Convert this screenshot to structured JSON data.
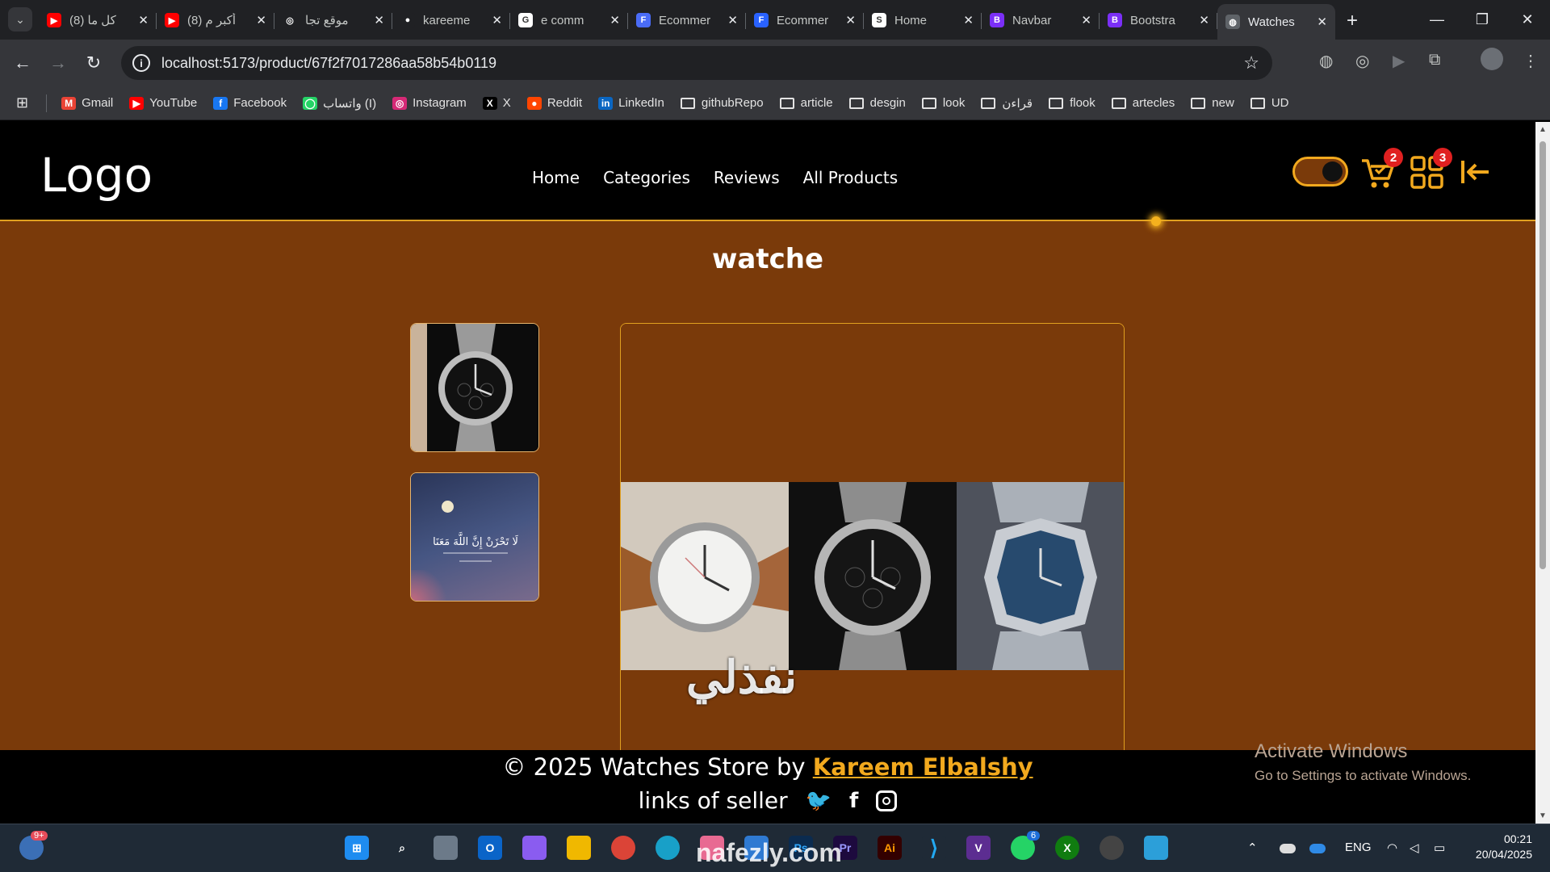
{
  "browser": {
    "tabs": [
      {
        "title": "(8) كل ما",
        "fav_color": "#ff0000",
        "fav_glyph": "▶"
      },
      {
        "title": "(8) أكبر م",
        "fav_color": "#ff0000",
        "fav_glyph": "▶"
      },
      {
        "title": "موقع تجا",
        "fav_color": "#202124",
        "fav_glyph": "◎"
      },
      {
        "title": "kareeme",
        "fav_color": "#202124",
        "fav_glyph": "●"
      },
      {
        "title": "e comm",
        "fav_color": "#ffffff",
        "fav_glyph": "G"
      },
      {
        "title": "Ecommer",
        "fav_color": "#4a6cf7",
        "fav_glyph": "F"
      },
      {
        "title": "Ecommer",
        "fav_color": "#2962ff",
        "fav_glyph": "F"
      },
      {
        "title": "Home",
        "fav_color": "#ffffff",
        "fav_glyph": "S"
      },
      {
        "title": "Navbar",
        "fav_color": "#7b2ff7",
        "fav_glyph": "B"
      },
      {
        "title": "Bootstra",
        "fav_color": "#7b2ff7",
        "fav_glyph": "B"
      },
      {
        "title": "Watches",
        "fav_color": "#5f6368",
        "fav_glyph": "◍"
      }
    ],
    "url": "localhost:5173/product/67f2f7017286aa58b54b0119",
    "bookmarks": [
      {
        "label": "Gmail",
        "type": "gmail"
      },
      {
        "label": "YouTube",
        "type": "youtube"
      },
      {
        "label": "Facebook",
        "type": "facebook"
      },
      {
        "label": "واتساب (I)",
        "type": "whatsapp"
      },
      {
        "label": "Instagram",
        "type": "instagram"
      },
      {
        "label": "X",
        "type": "x"
      },
      {
        "label": "Reddit",
        "type": "reddit"
      },
      {
        "label": "LinkedIn",
        "type": "linkedin"
      },
      {
        "label": "githubRepo",
        "type": "folder"
      },
      {
        "label": "article",
        "type": "folder"
      },
      {
        "label": "desgin",
        "type": "folder"
      },
      {
        "label": "look",
        "type": "folder"
      },
      {
        "label": "قراءن",
        "type": "folder"
      },
      {
        "label": "flook",
        "type": "folder"
      },
      {
        "label": "artecles",
        "type": "folder"
      },
      {
        "label": "new",
        "type": "folder"
      },
      {
        "label": "UD",
        "type": "folder"
      }
    ]
  },
  "site": {
    "logo": "Logo",
    "nav": [
      "Home",
      "Categories",
      "Reviews",
      "All Products"
    ],
    "cart_count": "2",
    "grid_count": "3",
    "accent": "#f2a91e",
    "page_bg": "#7a3a0a"
  },
  "product": {
    "title": "watche",
    "thumb2_arabic": "لَا تَحْزَنْ إِنَّ اللَّهَ مَعَنَا"
  },
  "footer": {
    "copyright": "© 2025 Watches Store by ",
    "author": "Kareem Elbalshy",
    "seller_label": "links of seller"
  },
  "windows": {
    "activate_title": "Activate Windows",
    "activate_sub": "Go to Settings to activate Windows.",
    "weather_badge": "9+",
    "whatsapp_badge": "6",
    "lang": "ENG",
    "time": "00:21",
    "date": "20/04/2025"
  },
  "watermark": {
    "arabic": "نفذلي",
    "domain": "nafezly.com"
  }
}
